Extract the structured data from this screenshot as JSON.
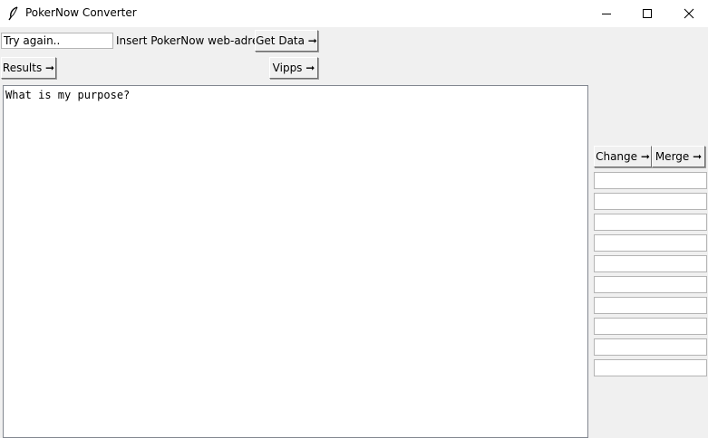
{
  "window": {
    "title": "PokerNow Converter",
    "icon": "feather-icon",
    "controls": [
      "minimize-icon",
      "maximize-icon",
      "close-icon"
    ]
  },
  "url_input": {
    "value": "Try again.."
  },
  "url_label": "Insert PokerNow web-adress",
  "get_data_button": "Get Data ➞",
  "results_button": "Results ➞",
  "vipps_button": "Vipps ➞",
  "output_text": "What is my purpose?",
  "change_button": "Change ➞",
  "merge_button": "Merge ➞",
  "side_entries": [
    "",
    "",
    "",
    "",
    "",
    "",
    "",
    "",
    "",
    ""
  ]
}
